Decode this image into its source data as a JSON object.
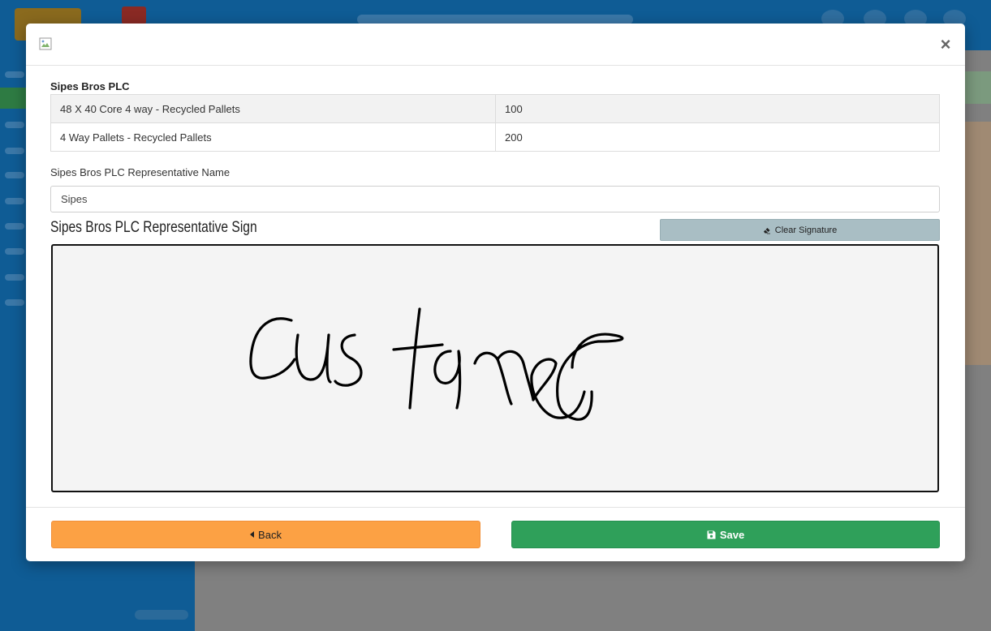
{
  "modal": {
    "header_image_icon": "broken-image-icon",
    "close_label": "×",
    "company_name": "Sipes Bros PLC",
    "items": [
      {
        "product": "48 X 40 Core 4 way - Recycled Pallets",
        "quantity": "100"
      },
      {
        "product": "4 Way Pallets - Recycled Pallets",
        "quantity": "200"
      }
    ],
    "rep_name_label": "Sipes Bros PLC Representative Name",
    "rep_name_value": "Sipes",
    "sign_title": "Sipes Bros PLC Representative Sign",
    "clear_signature_label": "Clear Signature",
    "clear_signature_icon": "eraser-icon",
    "signature_text": "customer"
  },
  "footer": {
    "back_label": "Back",
    "back_icon": "caret-left-icon",
    "save_label": "Save",
    "save_icon": "floppy-disk-icon"
  },
  "colors": {
    "back_button": "#fca144",
    "save_button": "#2fa05a",
    "clear_button": "#a9bec4",
    "signature_pad": "#f4f4f4",
    "app_header": "#0f5c95"
  }
}
